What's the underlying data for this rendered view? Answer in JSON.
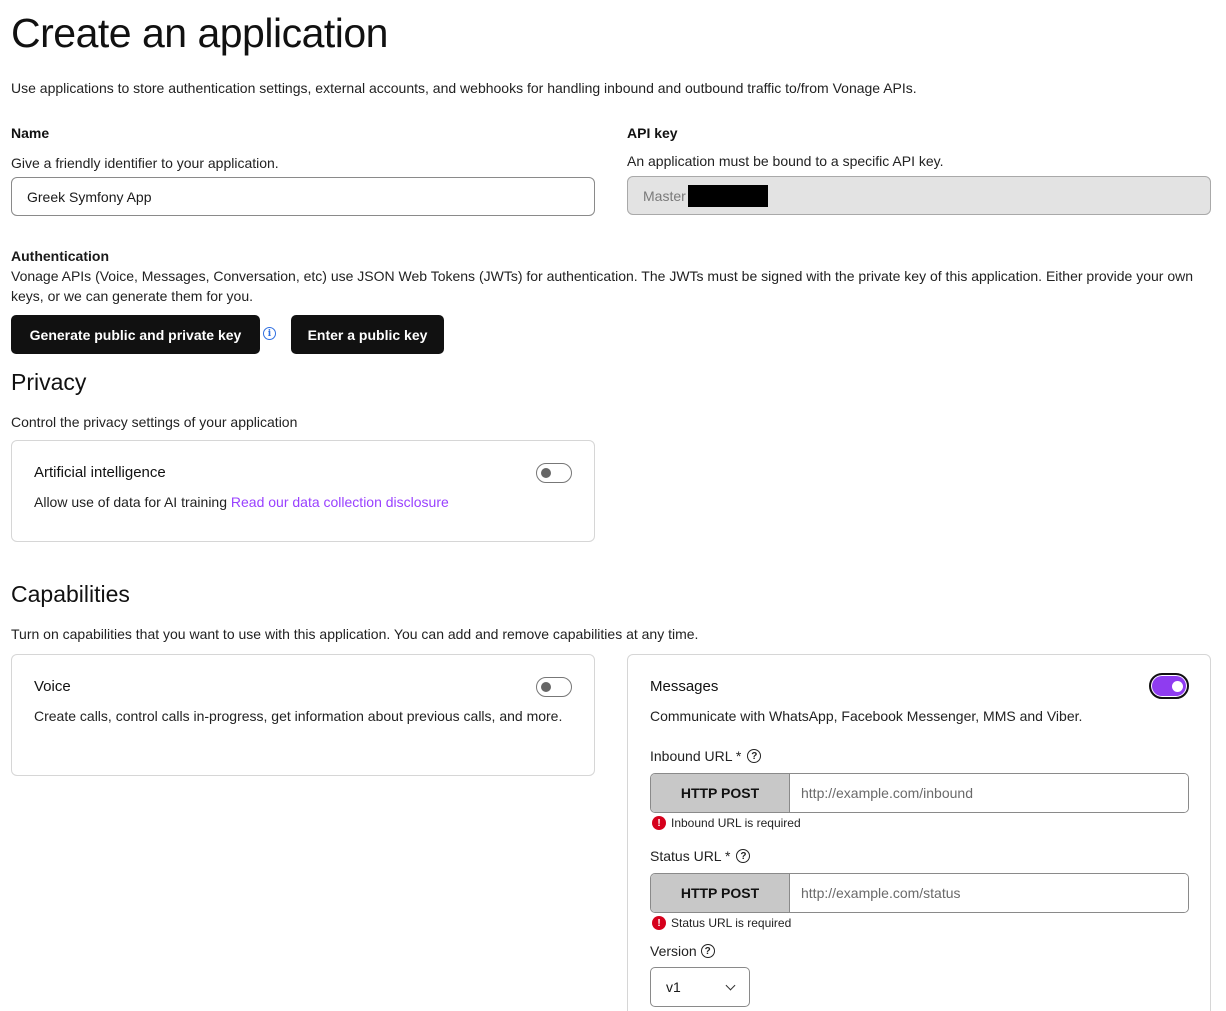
{
  "page": {
    "title": "Create an application",
    "intro": "Use applications to store authentication settings, external accounts, and webhooks for handling inbound and outbound traffic to/from Vonage APIs."
  },
  "name": {
    "label": "Name",
    "help": "Give a friendly identifier to your application.",
    "value": "Greek Symfony App"
  },
  "api_key": {
    "label": "API key",
    "help": "An application must be bound to a specific API key.",
    "value": "Master ("
  },
  "authentication": {
    "title": "Authentication",
    "description": "Vonage APIs (Voice, Messages, Conversation, etc) use JSON Web Tokens (JWTs) for authentication. The JWTs must be signed with the private key of this application. Either provide your own keys, or we can generate them for you.",
    "generate_label": "Generate public and private key",
    "enter_label": "Enter a public key",
    "info_glyph": "i"
  },
  "privacy": {
    "title": "Privacy",
    "description": "Control the privacy settings of your application",
    "ai": {
      "title": "Artificial intelligence",
      "description": "Allow use of data for AI training",
      "link": "Read our data collection disclosure",
      "enabled": false
    }
  },
  "capabilities": {
    "title": "Capabilities",
    "description": "Turn on capabilities that you want to use with this application. You can add and remove capabilities at any time.",
    "voice": {
      "title": "Voice",
      "description": "Create calls, control calls in-progress, get information about previous calls, and more.",
      "enabled": false
    },
    "messages": {
      "title": "Messages",
      "description": "Communicate with WhatsApp, Facebook Messenger, MMS and Viber.",
      "enabled": true,
      "inbound": {
        "label": "Inbound URL *",
        "method": "HTTP POST",
        "placeholder": "http://example.com/inbound",
        "error": "Inbound URL is required"
      },
      "status": {
        "label": "Status URL *",
        "method": "HTTP POST",
        "placeholder": "http://example.com/status",
        "error": "Status URL is required"
      },
      "version": {
        "label": "Version",
        "selected": "v1"
      },
      "help_glyph": "?",
      "error_glyph": "!"
    }
  },
  "colors": {
    "accent": "#9941ff",
    "toggle_on": "#8f3cf0",
    "error": "#d6001c",
    "button_dark": "#111111"
  }
}
